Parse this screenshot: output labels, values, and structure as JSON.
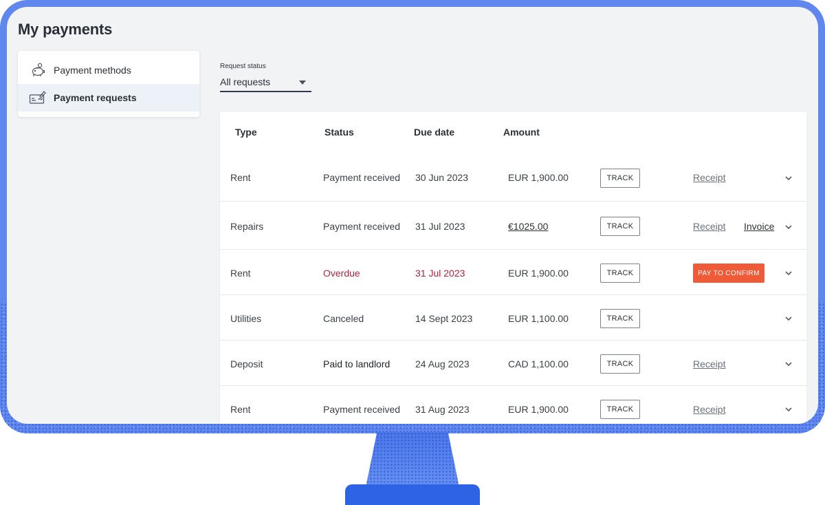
{
  "page": {
    "title": "My payments"
  },
  "sidebar": {
    "items": [
      {
        "label": "Payment methods",
        "icon": "piggy-bank-icon",
        "active": false
      },
      {
        "label": "Payment requests",
        "icon": "payment-request-icon",
        "active": true
      }
    ]
  },
  "filter": {
    "label": "Request status",
    "value": "All requests"
  },
  "table": {
    "headers": {
      "type": "Type",
      "status": "Status",
      "due": "Due date",
      "amount": "Amount"
    },
    "rows": [
      {
        "type": "Rent",
        "status": "Payment received",
        "due": "30 Jun 2023",
        "amount": "EUR 1,900.00",
        "track": "TRACK",
        "receipt": "Receipt"
      },
      {
        "type": "Repairs",
        "status": "Payment received",
        "due": "31 Jul 2023",
        "amount": "€1025.00",
        "track": "TRACK",
        "receipt": "Receipt",
        "invoice": "Invoice"
      },
      {
        "type": "Rent",
        "status": "Overdue",
        "due": "31 Jul 2023",
        "amount": "EUR 1,900.00",
        "track": "TRACK",
        "pay": "PAY TO CONFIRM"
      },
      {
        "type": "Utilities",
        "status": "Canceled",
        "due": "14 Sept 2023",
        "amount": "EUR 1,100.00",
        "track": "TRACK"
      },
      {
        "type": "Deposit",
        "status": "Paid to landlord",
        "due": "24 Aug 2023",
        "amount": "CAD 1,100.00",
        "track": "TRACK",
        "receipt": "Receipt"
      },
      {
        "type": "Rent",
        "status": "Payment received",
        "due": "31 Aug 2023",
        "amount": "EUR 1,900.00",
        "track": "TRACK",
        "receipt": "Receipt"
      }
    ]
  },
  "colors": {
    "frame": "#5f87ee",
    "overdue": "#b4233c",
    "pay_button": "#ef5a38",
    "active_nav": "#edf2f8"
  }
}
